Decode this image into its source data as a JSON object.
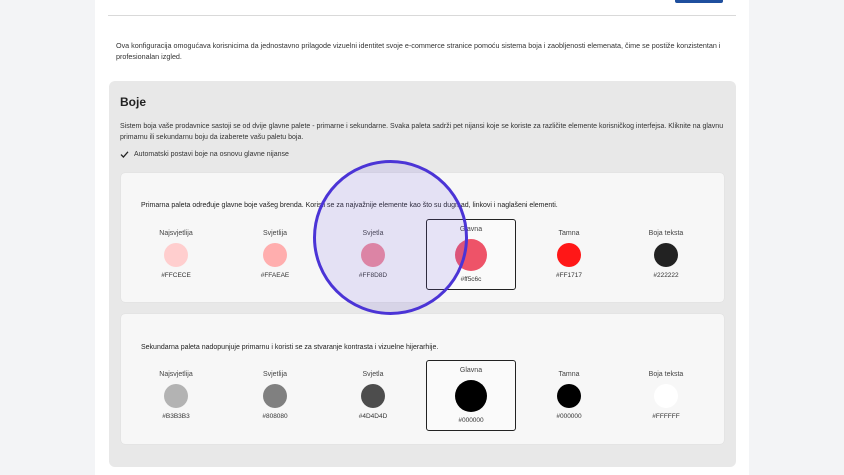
{
  "intro": "Ova konfiguracija omogućava korisnicima da jednostavno prilagode vizuelni identitet svoje e-commerce stranice pomoću sistema boja i zaobljenosti elemenata, čime se postiže konzistentan i profesionalan izgled.",
  "colors": {
    "section": {
      "title": "Boje",
      "description": "Sistem boja vaše prodavnice sastoji se od dvije glavne palete - primarne i sekundarne. Svaka paleta sadrži pet nijansi koje se koriste za različite elemente korisničkog interfejsa. Kliknite na glavnu primarnu ili sekundarnu boju da izaberete vašu paletu boja.",
      "auto_label": "Automatski postavi boje na osnovu glavne nijanse",
      "auto_checked": true
    },
    "primary": {
      "description": "Primarna paleta određuje glavne boje vašeg brenda. Koristi se za najvažnije elemente kao što su dugmad, linkovi i naglašeni elementi.",
      "swatches": [
        {
          "label": "Najsvjetlija",
          "hex": "#FFCECE",
          "color": "#FFCECE"
        },
        {
          "label": "Svjetlija",
          "hex": "#FFAEAE",
          "color": "#FFAEAE"
        },
        {
          "label": "Svjetla",
          "hex": "#FF8D8D",
          "color": "#EE8A9A"
        },
        {
          "label": "Glavna",
          "hex": "#ff5c6c",
          "color": "#EE5368"
        },
        {
          "label": "Tamna",
          "hex": "#FF1717",
          "color": "#FF1717"
        },
        {
          "label": "Boja teksta",
          "hex": "#222222",
          "color": "#222222"
        }
      ]
    },
    "secondary": {
      "description": "Sekundarna paleta nadopunjuje primarnu i koristi se za stvaranje kontrasta i vizuelne hijerarhije.",
      "swatches": [
        {
          "label": "Najsvjetlija",
          "hex": "#B3B3B3",
          "color": "#B3B3B3"
        },
        {
          "label": "Svjetlija",
          "hex": "#808080",
          "color": "#808080"
        },
        {
          "label": "Svjetla",
          "hex": "#4D4D4D",
          "color": "#4D4D4D"
        },
        {
          "label": "Glavna",
          "hex": "#000000",
          "color": "#000000"
        },
        {
          "label": "Tamna",
          "hex": "#000000",
          "color": "#000000"
        },
        {
          "label": "Boja teksta",
          "hex": "#FFFFFF",
          "color": "#FFFFFF"
        }
      ]
    }
  }
}
